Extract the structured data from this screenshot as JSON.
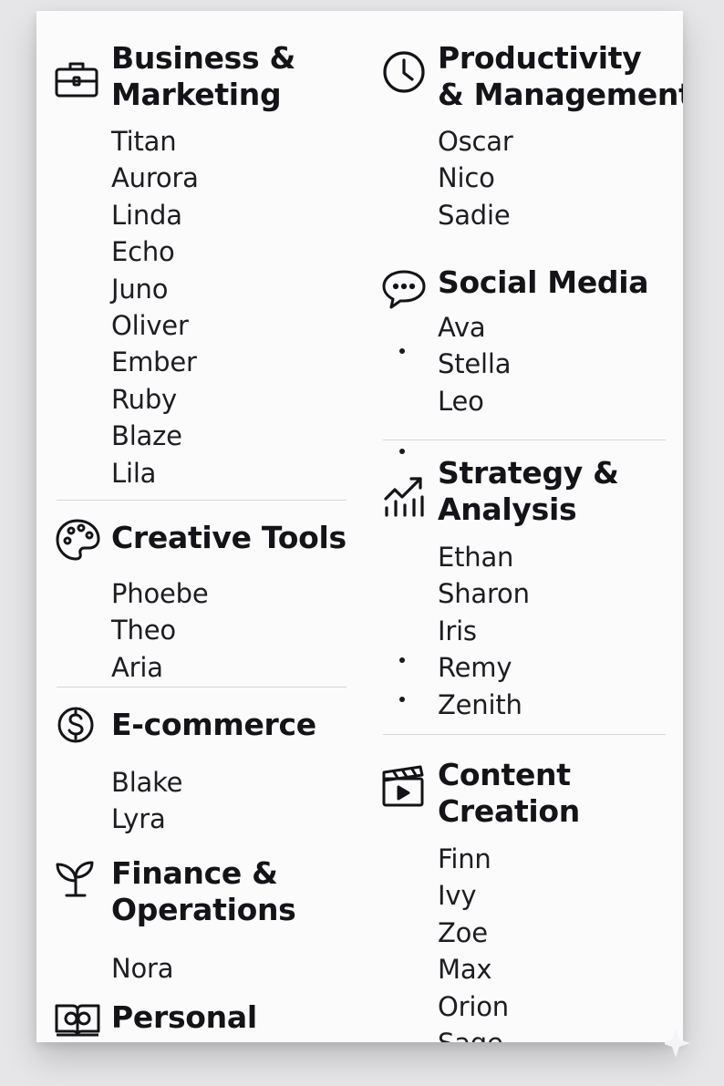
{
  "left_column": {
    "business": {
      "icon": "briefcase-icon",
      "title_line1": "Business &",
      "title_line2": "Marketing",
      "items": [
        "Titan",
        "Aurora",
        "Linda",
        "Echo",
        "Juno",
        "Oliver",
        "Ember",
        "Ruby",
        "Blaze",
        "Lila"
      ]
    },
    "creative": {
      "icon": "palette-icon",
      "title": "Creative Tools",
      "items": [
        "Phoebe",
        "Theo",
        "Aria"
      ]
    },
    "ecommerce": {
      "icon": "dollar-circle-icon",
      "title": "E-commerce",
      "items": [
        "Blake",
        "Lyra"
      ]
    },
    "finance": {
      "icon": "plant-sprout-icon",
      "title_line1": "Finance &",
      "title_line2": "Operations",
      "items": [
        "Nora"
      ]
    },
    "personal": {
      "icon": "book-brain-icon",
      "title": "Personal"
    }
  },
  "right_column": {
    "productivity": {
      "icon": "clock-icon",
      "title_line1": "Productivity",
      "title_line2": "& Management",
      "items": [
        "Oscar",
        "Nico",
        "Sadie"
      ]
    },
    "social": {
      "icon": "chat-bubble-icon",
      "title": "Social Media",
      "items": [
        "Ava",
        "Stella",
        "Leo"
      ]
    },
    "strategy": {
      "icon": "growth-chart-icon",
      "title_line1": "Strategy &",
      "title_line2": "Analysis",
      "items": [
        "Ethan",
        "Sharon",
        "Iris",
        "Remy",
        "Zenith"
      ]
    },
    "content": {
      "icon": "clapperboard-icon",
      "title_line1": "Content",
      "title_line2": "Creation",
      "items": [
        "Finn",
        "Ivy",
        "Zoe",
        "Max",
        "Orion",
        "Sage"
      ]
    }
  }
}
